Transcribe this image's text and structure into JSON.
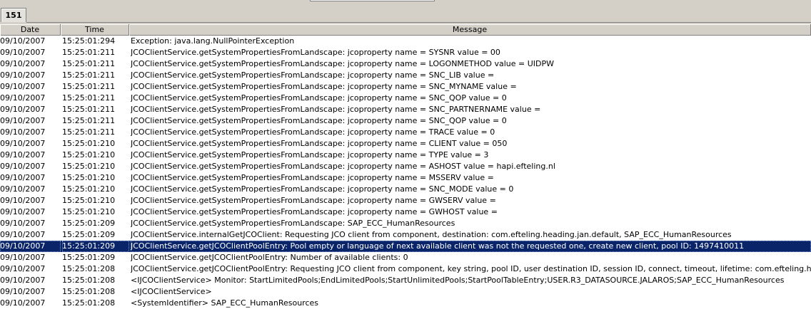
{
  "tab": {
    "label": "151"
  },
  "columns": {
    "date": "Date",
    "time": "Time",
    "message": "Message"
  },
  "selected_index": 18,
  "rows": [
    {
      "date": "09/10/2007",
      "time": "15:25:01:294",
      "message": "Exception: java.lang.NullPointerException"
    },
    {
      "date": "09/10/2007",
      "time": "15:25:01:211",
      "message": "JCOClientService.getSystemPropertiesFromLandscape: jcoproperty name = SYSNR value = 00"
    },
    {
      "date": "09/10/2007",
      "time": "15:25:01:211",
      "message": "JCOClientService.getSystemPropertiesFromLandscape: jcoproperty name = LOGONMETHOD value = UIDPW"
    },
    {
      "date": "09/10/2007",
      "time": "15:25:01:211",
      "message": "JCOClientService.getSystemPropertiesFromLandscape: jcoproperty name = SNC_LIB value ="
    },
    {
      "date": "09/10/2007",
      "time": "15:25:01:211",
      "message": "JCOClientService.getSystemPropertiesFromLandscape: jcoproperty name = SNC_MYNAME value ="
    },
    {
      "date": "09/10/2007",
      "time": "15:25:01:211",
      "message": "JCOClientService.getSystemPropertiesFromLandscape: jcoproperty name = SNC_QOP value = 0"
    },
    {
      "date": "09/10/2007",
      "time": "15:25:01:211",
      "message": "JCOClientService.getSystemPropertiesFromLandscape: jcoproperty name = SNC_PARTNERNAME value ="
    },
    {
      "date": "09/10/2007",
      "time": "15:25:01:211",
      "message": "JCOClientService.getSystemPropertiesFromLandscape: jcoproperty name = SNC_QOP value = 0"
    },
    {
      "date": "09/10/2007",
      "time": "15:25:01:211",
      "message": "JCOClientService.getSystemPropertiesFromLandscape: jcoproperty name = TRACE value = 0"
    },
    {
      "date": "09/10/2007",
      "time": "15:25:01:210",
      "message": "JCOClientService.getSystemPropertiesFromLandscape: jcoproperty name = CLIENT value = 050"
    },
    {
      "date": "09/10/2007",
      "time": "15:25:01:210",
      "message": "JCOClientService.getSystemPropertiesFromLandscape: jcoproperty name = TYPE value = 3"
    },
    {
      "date": "09/10/2007",
      "time": "15:25:01:210",
      "message": "JCOClientService.getSystemPropertiesFromLandscape: jcoproperty name = ASHOST value = hapi.efteling.nl"
    },
    {
      "date": "09/10/2007",
      "time": "15:25:01:210",
      "message": "JCOClientService.getSystemPropertiesFromLandscape: jcoproperty name = MSSERV value ="
    },
    {
      "date": "09/10/2007",
      "time": "15:25:01:210",
      "message": "JCOClientService.getSystemPropertiesFromLandscape: jcoproperty name = SNC_MODE value = 0"
    },
    {
      "date": "09/10/2007",
      "time": "15:25:01:210",
      "message": "JCOClientService.getSystemPropertiesFromLandscape: jcoproperty name = GWSERV value ="
    },
    {
      "date": "09/10/2007",
      "time": "15:25:01:210",
      "message": "JCOClientService.getSystemPropertiesFromLandscape: jcoproperty name = GWHOST value ="
    },
    {
      "date": "09/10/2007",
      "time": "15:25:01:209",
      "message": "JCOClientService.getSystemPropertiesFromLandscape: SAP_ECC_HumanResources"
    },
    {
      "date": "09/10/2007",
      "time": "15:25:01:209",
      "message": "JCOClientService.internalGetJCOClient: Requesting JCO client from component, destination: com.efteling.heading.jan.default, SAP_ECC_HumanResources"
    },
    {
      "date": "09/10/2007",
      "time": "15:25:01:209",
      "message": "JCOClientService.getJCOClientPoolEntry: Pool empty or language of next available client was not the requested one, create new client, pool ID: 1497410011"
    },
    {
      "date": "09/10/2007",
      "time": "15:25:01:209",
      "message": "JCOClientService.getJCOClientPoolEntry: Number of available clients: 0"
    },
    {
      "date": "09/10/2007",
      "time": "15:25:01:208",
      "message": "JCOClientService.getJCOClientPoolEntry: Requesting JCO client from component, key string, pool ID, user destination ID, session ID, connect, timeout, lifetime: com.efteling.he"
    },
    {
      "date": "09/10/2007",
      "time": "15:25:01:208",
      "message": "<IJCOClientService> Monitor: StartLimitedPools;EndLimitedPools;StartUnlimitedPools;StartPoolTableEntry;USER.R3_DATASOURCE.JALAROS;SAP_ECC_HumanResources"
    },
    {
      "date": "09/10/2007",
      "time": "15:25:01:208",
      "message": "<IJCOClientService>"
    },
    {
      "date": "09/10/2007",
      "time": "15:25:01:208",
      "message": "<SystemIdentifier> SAP_ECC_HumanResources"
    }
  ]
}
